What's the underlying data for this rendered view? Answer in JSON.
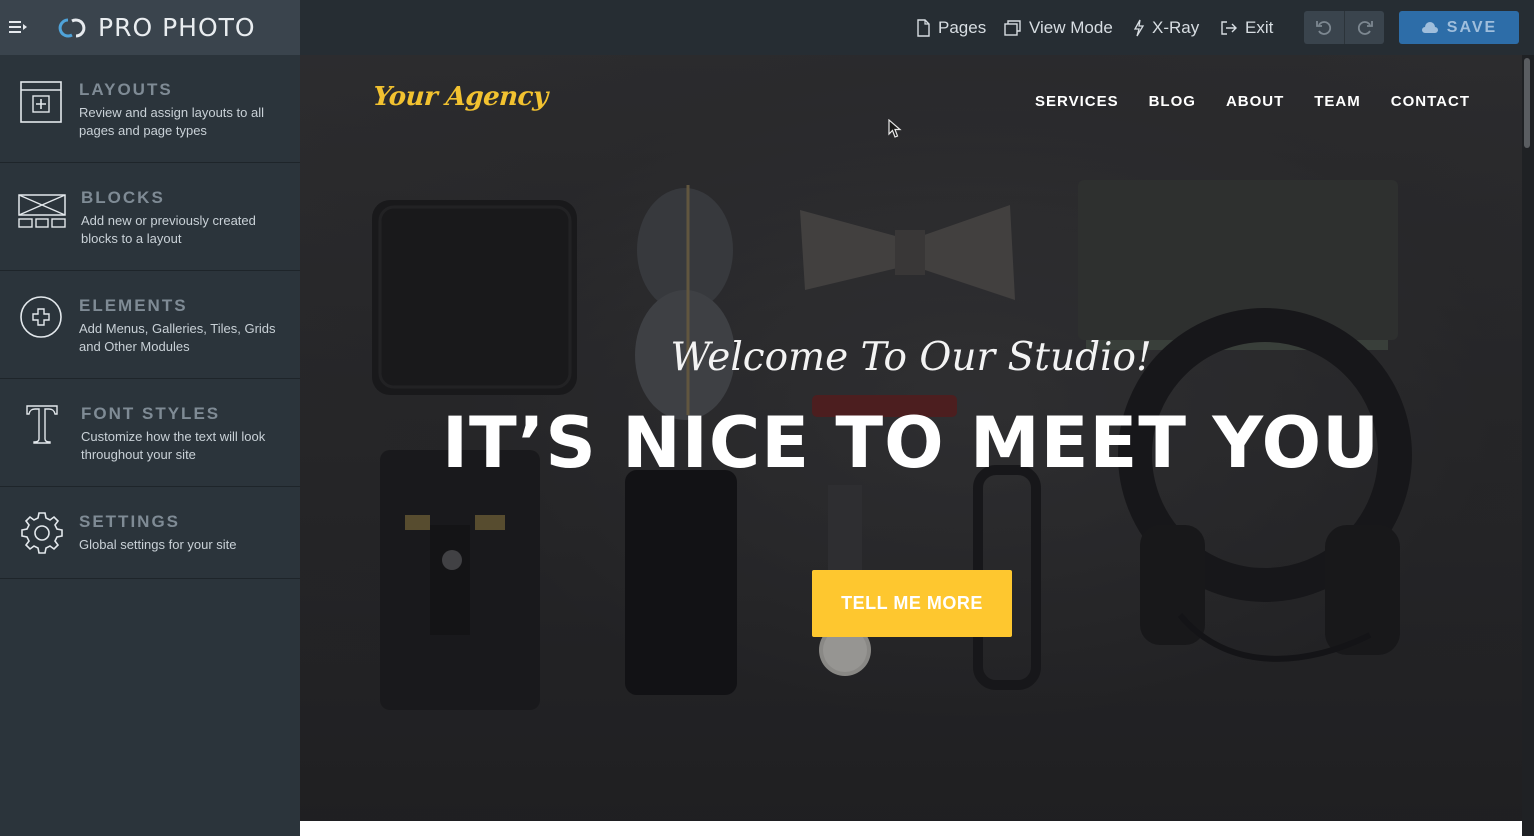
{
  "brand": {
    "name": "PRO PHOTO",
    "icon": "prophoto-logo-icon"
  },
  "toolbar": {
    "pages_label": "Pages",
    "view_mode_label": "View Mode",
    "xray_label": "X-Ray",
    "exit_label": "Exit",
    "save_label": "SAVE"
  },
  "sidebar": {
    "items": [
      {
        "title": "LAYOUTS",
        "desc": "Review and assign layouts to all pages and page types",
        "icon": "layout-icon"
      },
      {
        "title": "BLOCKS",
        "desc": "Add new or previously created blocks to a layout",
        "icon": "blocks-icon"
      },
      {
        "title": "ELEMENTS",
        "desc": "Add Menus, Galleries, Tiles, Grids and Other Modules",
        "icon": "plus-circle-icon"
      },
      {
        "title": "FONT STYLES",
        "desc": "Customize how the text will look throughout your site",
        "icon": "font-icon"
      },
      {
        "title": "SETTINGS",
        "desc": "Global settings for your site",
        "icon": "gear-icon"
      }
    ]
  },
  "site": {
    "logo": "Your Agency",
    "nav": [
      "SERVICES",
      "BLOG",
      "ABOUT",
      "TEAM",
      "CONTACT"
    ],
    "welcome": "Welcome To Our Studio!",
    "headline": "IT’S NICE TO MEET YOU",
    "cta": "TELL ME MORE"
  },
  "colors": {
    "accent": "#fec72f",
    "save": "#2d6da8",
    "sidebar": "#2b343b",
    "topbar": "#262d33"
  }
}
